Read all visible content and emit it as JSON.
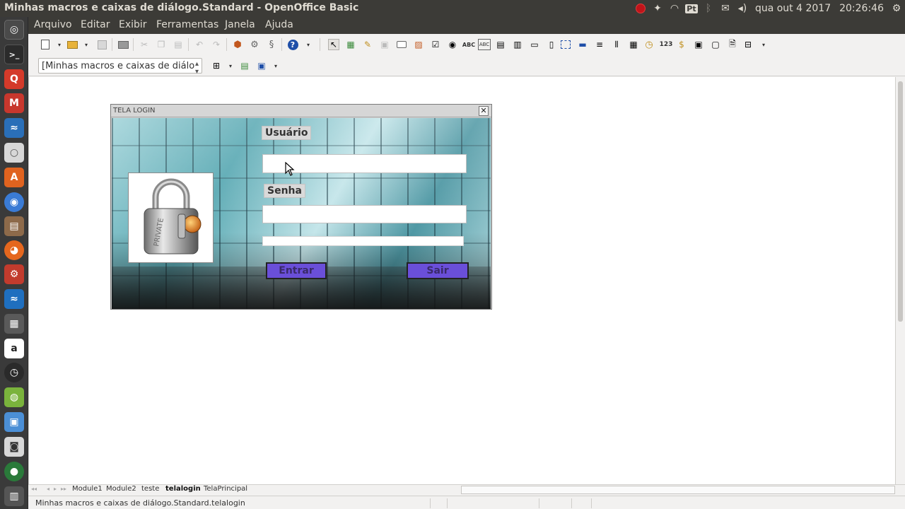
{
  "window": {
    "title": "Minhas macros e caixas de diálogo.Standard - OpenOffice Basic"
  },
  "tray": {
    "keyboard": "Pt",
    "date": "qua out  4 2017",
    "time": "20:26:46"
  },
  "menu": [
    "Arquivo",
    "Editar",
    "Exibir",
    "Ferramentas",
    "Janela",
    "Ajuda"
  ],
  "toolbar2": {
    "library": "[Minhas macros e caixas de diálo"
  },
  "toolbar1": {
    "abc_label": "ABC",
    "num_label": "123"
  },
  "launcher": {
    "amazon_label": "a"
  },
  "dialog": {
    "title": "TELA LOGIN",
    "close_glyph": "✕",
    "user_label": "Usuário",
    "password_label": "Senha",
    "enter_button": "Entrar",
    "exit_button": "Sair",
    "lock_engraving": "PRIVATE"
  },
  "sheet_tabs": [
    "Module1",
    "Module2",
    "teste",
    "telalogin",
    "TelaPrincipal"
  ],
  "active_tab": "telalogin",
  "status": {
    "text": "Minhas macros e caixas de diálogo.Standard.telalogin"
  },
  "colors": {
    "panel": "#3c3b37",
    "button": "#6a4fd9",
    "accent": "#e95420"
  }
}
